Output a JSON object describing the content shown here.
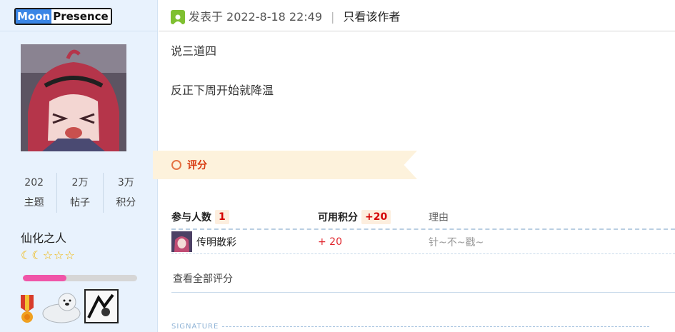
{
  "user": {
    "name_part1": "Moon",
    "name_part2": "Presence",
    "stats": [
      {
        "value": "202",
        "label": "主题"
      },
      {
        "value": "2万",
        "label": "帖子"
      },
      {
        "value": "3万",
        "label": "积分"
      }
    ],
    "rank": "仙化之人",
    "rank_icons": [
      "moon-icon",
      "moon-icon",
      "star-icon",
      "star-icon",
      "star-icon"
    ],
    "level_progress": 0.38,
    "colors": {
      "name_highlight": "#3a86e6",
      "progress": "#f055a8"
    }
  },
  "post": {
    "posted_prefix": "发表于",
    "posted_time": "2022-8-18 22:49",
    "separator": "|",
    "author_only": "只看该作者",
    "lines": [
      "说三道四",
      "反正下周开始就降温"
    ]
  },
  "rating": {
    "title": "评分",
    "header": {
      "participants_label": "参与人数",
      "participants_count": "1",
      "points_label": "可用积分",
      "points_total": "+20",
      "reason_label": "理由"
    },
    "rows": [
      {
        "user": "传明散彩",
        "points": "+ 20",
        "reason": "针~不~戳~"
      }
    ],
    "view_all": "查看全部评分",
    "colors": {
      "banner": "#fdf2dc",
      "points": "#e0242c"
    }
  },
  "signature": {
    "label": "SIGNATURE"
  }
}
